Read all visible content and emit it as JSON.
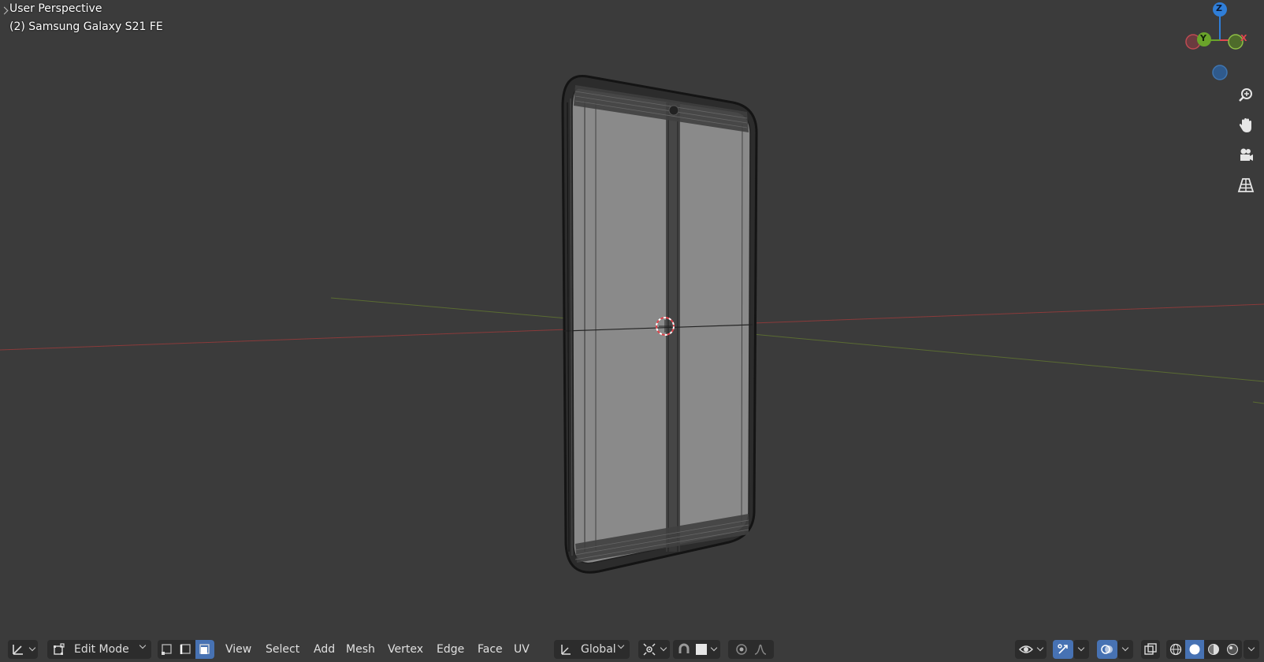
{
  "viewport": {
    "view_name": "User Perspective",
    "object_name": "(2) Samsung Galaxy S21 FE"
  },
  "gizmo": {
    "axis_z": "Z",
    "axis_y": "Y",
    "axis_x": "X"
  },
  "nav_tools": [
    "zoom-icon",
    "hand-pan-icon",
    "camera-icon",
    "grid-perspective-icon"
  ],
  "header": {
    "mode_label": "Edit Mode",
    "menus": [
      "View",
      "Select",
      "Add",
      "Mesh",
      "Vertex",
      "Edge",
      "Face",
      "UV"
    ],
    "orientation_label": "Global",
    "select_modes": [
      "vertex-select-icon",
      "edge-select-icon",
      "face-select-icon"
    ],
    "active_select_mode": "face"
  },
  "colors": {
    "background": "#3b3b3b",
    "axis_x": "#e0464e",
    "axis_y": "#6aa42a",
    "axis_z": "#2f7ed8",
    "active_blue": "#4772b3"
  }
}
